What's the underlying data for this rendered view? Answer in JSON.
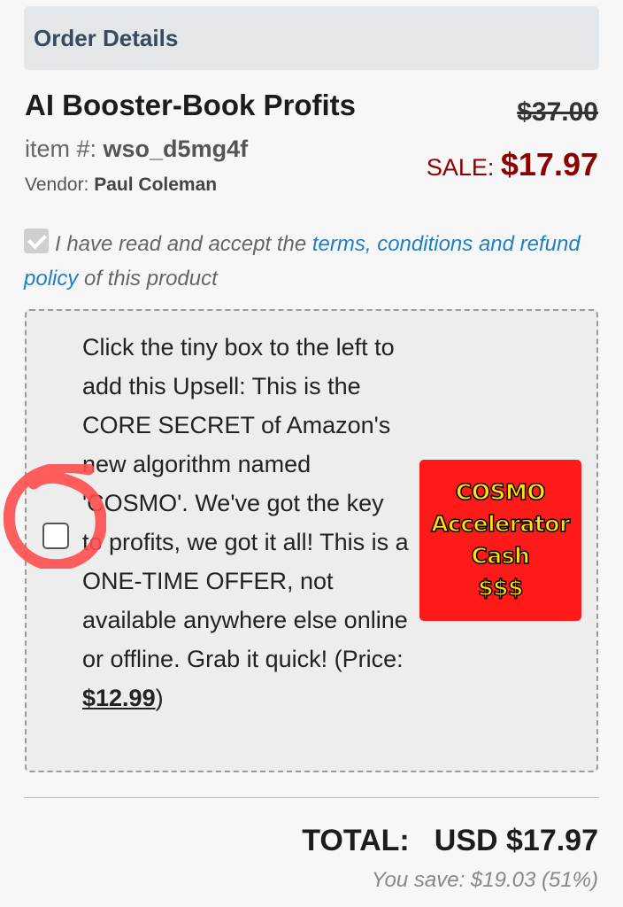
{
  "header": {
    "title": "Order Details"
  },
  "product": {
    "title": "AI Booster-Book Profits",
    "original_price": "$37.00",
    "item_label": "item #: ",
    "item_id": "wso_d5mg4f",
    "sale_label": "SALE: ",
    "sale_price": "$17.97",
    "vendor_label": "Vendor: ",
    "vendor_name": "Paul Coleman"
  },
  "terms": {
    "checked": true,
    "text_before": "I have read and accept the ",
    "link_text": "terms, conditions and refund policy",
    "text_after": " of this product"
  },
  "upsell": {
    "checked": false,
    "description": "Click the tiny box to the left to add this Upsell: This is the CORE SECRET of Amazon's new algorithm named 'COSMO'. We've got the key to profits, we got it all! This is a ONE-TIME OFFER, not available anywhere else online or offline. Grab it quick! (Price: ",
    "price": "$12.99",
    "price_close": ")",
    "image_lines": [
      "COSMO",
      "Accelerator",
      "Cash",
      "$$$"
    ],
    "image_bg": "#ff1a1a",
    "image_text_color": "#ffe600"
  },
  "annotation": {
    "color": "#ff4d4d"
  },
  "total": {
    "label": "TOTAL:",
    "amount": "USD $17.97",
    "savings": "You save: $19.03 (51%)"
  }
}
